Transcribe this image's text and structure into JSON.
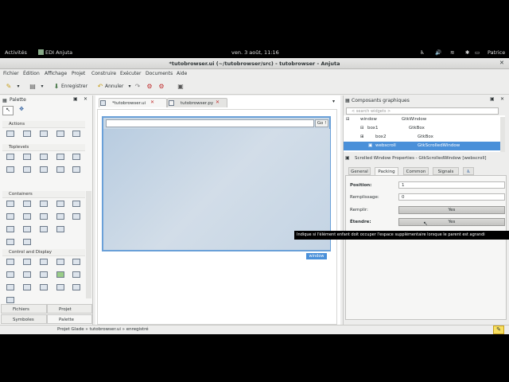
{
  "topbar": {
    "activities": "Activités",
    "app": "EDI Anjuta",
    "clock": "ven. 3 août, 11:16",
    "user": "Patrice"
  },
  "window": {
    "title": "*tutobrowser.ui (~/tutobrowser/src) - tutobrowser - Anjuta"
  },
  "menubar": [
    "Fichier",
    "Édition",
    "Affichage",
    "Projet",
    "Construire",
    "Exécuter",
    "Documents",
    "Aide"
  ],
  "toolbar": {
    "save_label": "Enregistrer",
    "undo_label": "Annuler"
  },
  "palette": {
    "title": "Palette",
    "sections": [
      "Actions",
      "Toplevels",
      "Containers",
      "Control and Display"
    ]
  },
  "left_tabs": [
    "Fichiers",
    "Projet",
    "Symboles",
    "Palette"
  ],
  "doc_tabs": [
    "*tutobrowser.ui",
    "tutobrowser.py"
  ],
  "design": {
    "go_label": "Go !",
    "window_label": "window"
  },
  "inspector": {
    "title": "Composants graphiques",
    "search_placeholder": "< search widgets >",
    "tree": [
      {
        "name": "window",
        "type": "GtkWindow"
      },
      {
        "name": "box1",
        "type": "GtkBox"
      },
      {
        "name": "box2",
        "type": "GtkBox"
      },
      {
        "name": "webscroll",
        "type": "GtkScrolledWindow"
      }
    ],
    "props_title": "Scrolled Window Properties - GtkScrolledWindow [webscroll]",
    "tabs": [
      "General",
      "Packing",
      "Common",
      "Signals"
    ],
    "props": {
      "position_label": "Position:",
      "position_value": "1",
      "padding_label": "Remplissage:",
      "padding_value": "0",
      "fill_label": "Remplir:",
      "fill_value": "Yes",
      "expand_label": "Étendre:",
      "expand_value": "Yes"
    },
    "tooltip": "Indique si l'élément enfant doit occuper l'espace supplémentaire lorsque le parent est agrandi"
  },
  "statusbar": {
    "text": "Projet Glade » tutobrowser.ui » enregistré"
  }
}
